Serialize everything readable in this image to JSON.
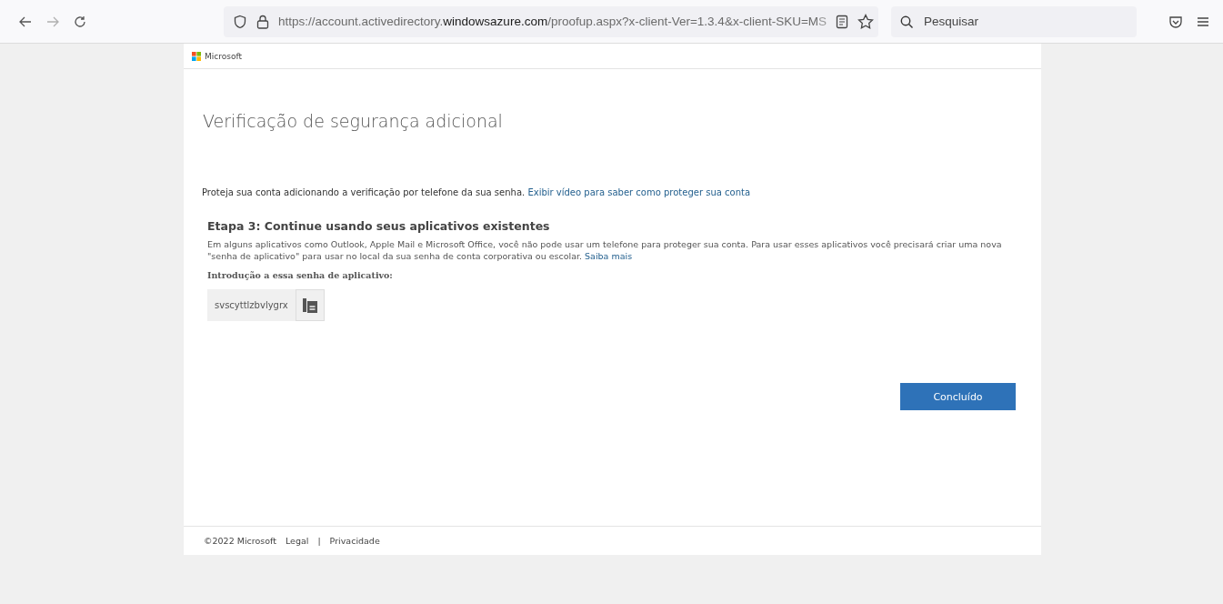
{
  "browser": {
    "url_start": "https://account.activedirectory.",
    "url_host": "windowsazure.com",
    "url_path": "/proofup.aspx?x-client-Ver=1.3.4&x-client-SKU=M",
    "url_faded": "S",
    "search_placeholder": "Pesquisar",
    "forward_disabled": true
  },
  "header": {
    "brand": "Microsoft"
  },
  "title": "Verificação de segurança adicional",
  "intro": {
    "text": "Proteja sua conta adicionando a verificação por telefone da sua senha.",
    "link": "Exibir vídeo para saber como proteger sua conta"
  },
  "step": {
    "heading": "Etapa 3: Continue usando seus aplicativos existentes",
    "text": "Em alguns aplicativos como Outlook, Apple Mail e Microsoft Office, você não pode usar um telefone para proteger sua conta. Para usar esses aplicativos você precisará criar uma nova \"senha de aplicativo\" para usar no local da sua senha de conta corporativa ou escolar.",
    "link": "Saiba mais",
    "password_label": "Introdução a essa senha de aplicativo:",
    "password": "svscyttlzbvlygrx"
  },
  "done_button": "Concluído",
  "footer": {
    "copyright": "©2022 Microsoft",
    "links": [
      "Legal",
      "Privacidade"
    ],
    "separator": "|"
  }
}
